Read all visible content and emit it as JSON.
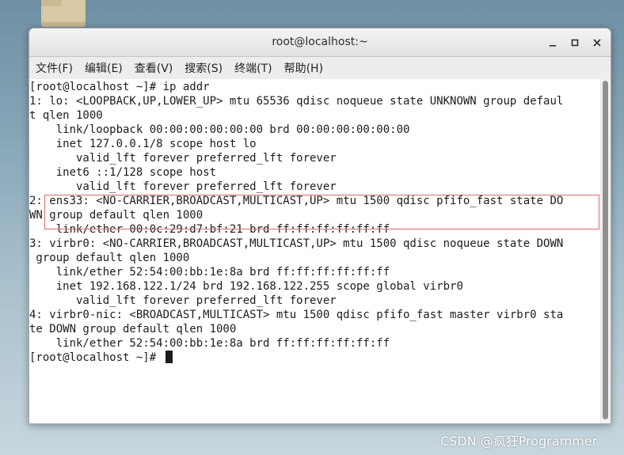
{
  "window": {
    "title": "root@localhost:~"
  },
  "menu": [
    {
      "label": "文件(F)"
    },
    {
      "label": "编辑(E)"
    },
    {
      "label": "查看(V)"
    },
    {
      "label": "搜索(S)"
    },
    {
      "label": "终端(T)"
    },
    {
      "label": "帮助(H)"
    }
  ],
  "terminal": {
    "lines": [
      "[root@localhost ~]# ip addr",
      "1: lo: <LOOPBACK,UP,LOWER_UP> mtu 65536 qdisc noqueue state UNKNOWN group defaul",
      "t qlen 1000",
      "    link/loopback 00:00:00:00:00:00 brd 00:00:00:00:00:00",
      "    inet 127.0.0.1/8 scope host lo",
      "       valid_lft forever preferred_lft forever",
      "    inet6 ::1/128 scope host",
      "       valid_lft forever preferred_lft forever",
      "2: ens33: <NO-CARRIER,BROADCAST,MULTICAST,UP> mtu 1500 qdisc pfifo_fast state DO",
      "WN group default qlen 1000",
      "    link/ether 00:0c:29:d7:bf:21 brd ff:ff:ff:ff:ff:ff",
      "3: virbr0: <NO-CARRIER,BROADCAST,MULTICAST,UP> mtu 1500 qdisc noqueue state DOWN",
      " group default qlen 1000",
      "    link/ether 52:54:00:bb:1e:8a brd ff:ff:ff:ff:ff:ff",
      "    inet 192.168.122.1/24 brd 192.168.122.255 scope global virbr0",
      "       valid_lft forever preferred_lft forever",
      "4: virbr0-nic: <BROADCAST,MULTICAST> mtu 1500 qdisc pfifo_fast master virbr0 sta",
      "te DOWN group default qlen 1000",
      "    link/ether 52:54:00:bb:1e:8a brd ff:ff:ff:ff:ff:ff"
    ],
    "prompt": "[root@localhost ~]# "
  },
  "watermark": "CSDN @疯狂Programmer",
  "colors": {
    "highlight_border": "#d86c6c",
    "terminal_bg": "#ffffff",
    "terminal_fg": "#1c1c1c"
  }
}
